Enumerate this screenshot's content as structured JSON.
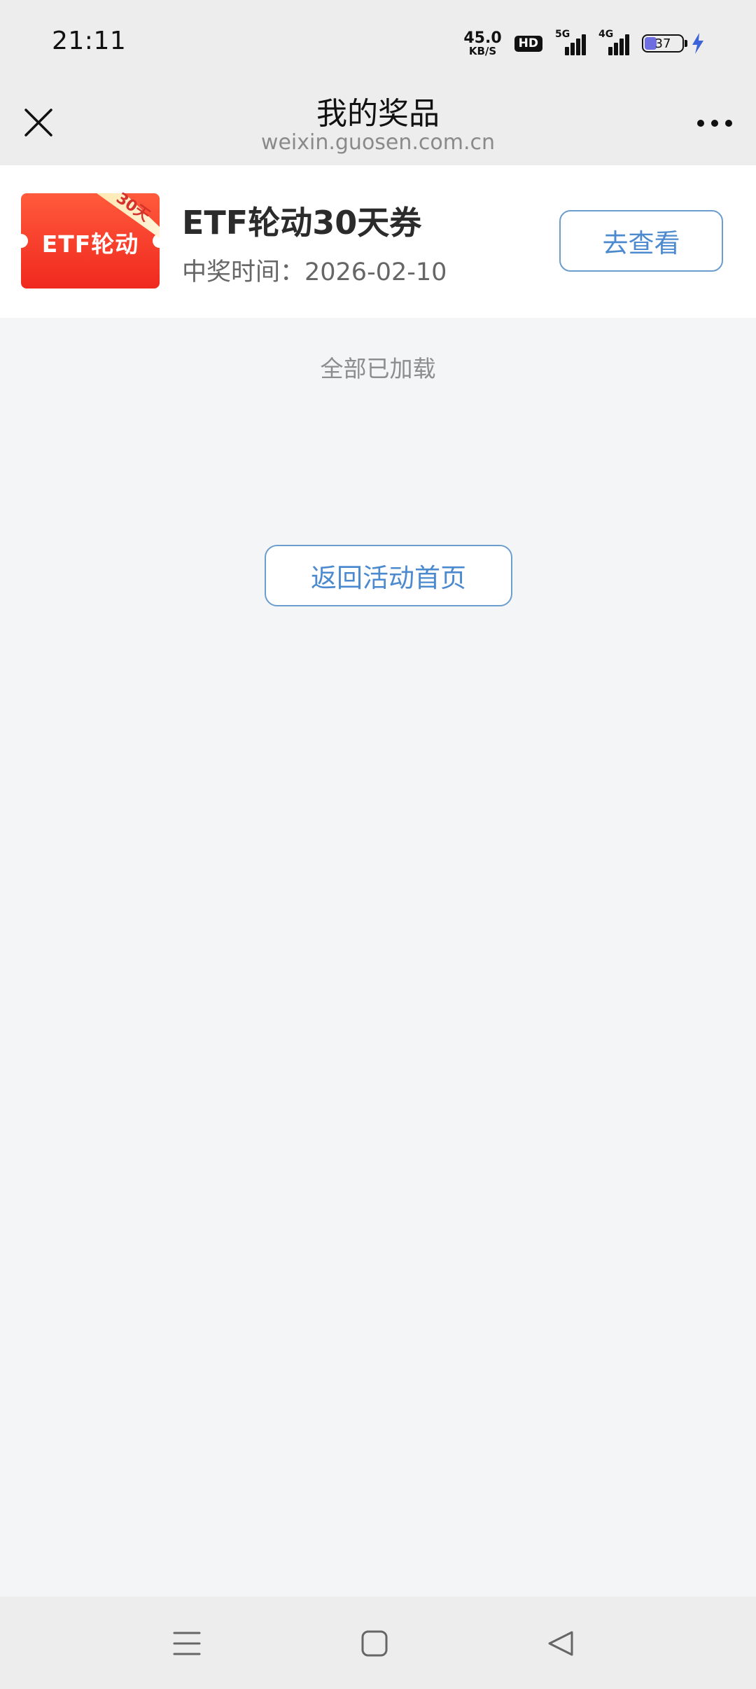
{
  "status_bar": {
    "time": "21:11",
    "net_speed_value": "45.0",
    "net_speed_unit": "KB/S",
    "hd_label": "HD",
    "sim1_tag": "5G",
    "sim2_tag": "4G",
    "battery_level": "37",
    "battery_fill_percent": 37,
    "charging": true
  },
  "nav": {
    "title": "我的奖品",
    "url": "weixin.guosen.com.cn",
    "close_icon": "close-icon",
    "more_icon": "more-icon"
  },
  "prize": {
    "coupon_label": "ETF轮动",
    "coupon_corner": "30天",
    "name": "ETF轮动30天券",
    "time": "中奖时间：2026-02-10",
    "view_button": "去查看"
  },
  "list": {
    "loaded_text": "全部已加载"
  },
  "back_button": "返回活动首页",
  "system_nav": {
    "menu_icon": "menu-icon",
    "home_icon": "home-icon",
    "back_icon": "back-triangle-icon"
  },
  "colors": {
    "accent": "#4c8ad0",
    "coupon_red": "#f03a24",
    "background": "#f4f5f7"
  }
}
